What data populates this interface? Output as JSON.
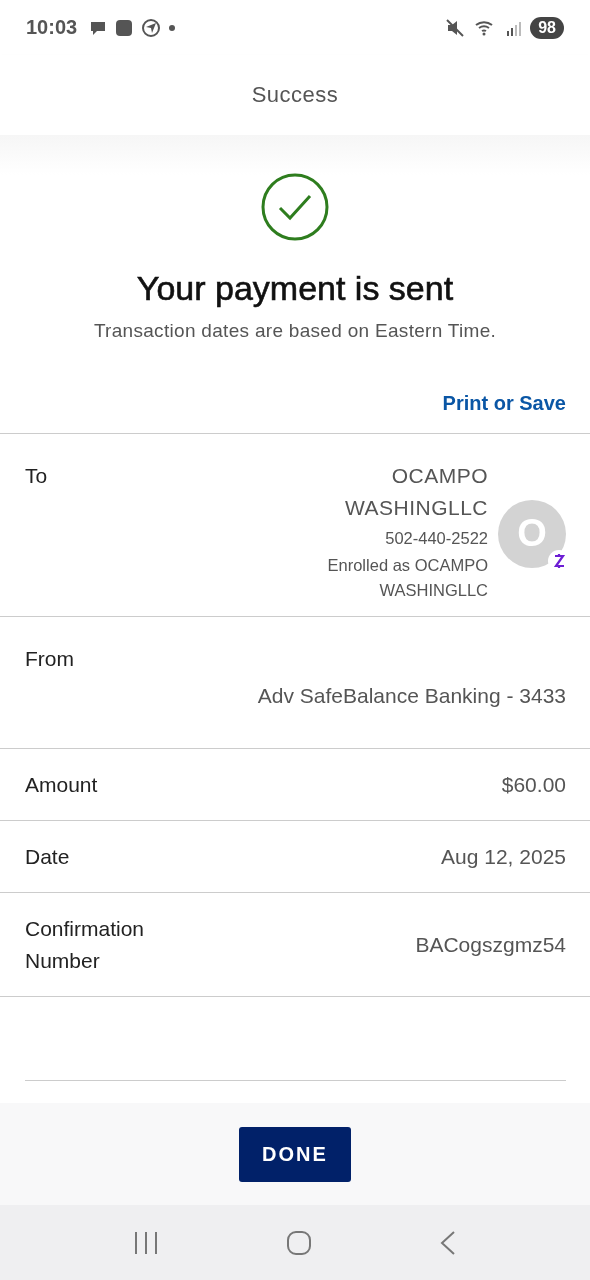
{
  "status_bar": {
    "time": "10:03",
    "battery": "98"
  },
  "header": {
    "title": "Success"
  },
  "confirmation": {
    "heading": "Your payment is sent",
    "note": "Transaction dates are based on Eastern Time.",
    "print_link": "Print or Save"
  },
  "details": [
    {
      "kind": "recipient",
      "label": "To",
      "lines": [
        "OCAMPO WASHINGLLC",
        "502-440-2522",
        "Enrolled as OCAMPO WASHINGLLC"
      ],
      "avatar": "O"
    },
    {
      "kind": "plain",
      "label": "From",
      "value": "Adv SafeBalance Banking - 3433"
    },
    {
      "kind": "plain",
      "label": "Amount",
      "value": "$60.00"
    },
    {
      "kind": "plain",
      "label": "Date",
      "value": "Aug 12, 2025"
    },
    {
      "kind": "plain",
      "label": "Confirmation Number",
      "value": "BACogszgmz54"
    }
  ],
  "footer": {
    "button": "DONE"
  }
}
